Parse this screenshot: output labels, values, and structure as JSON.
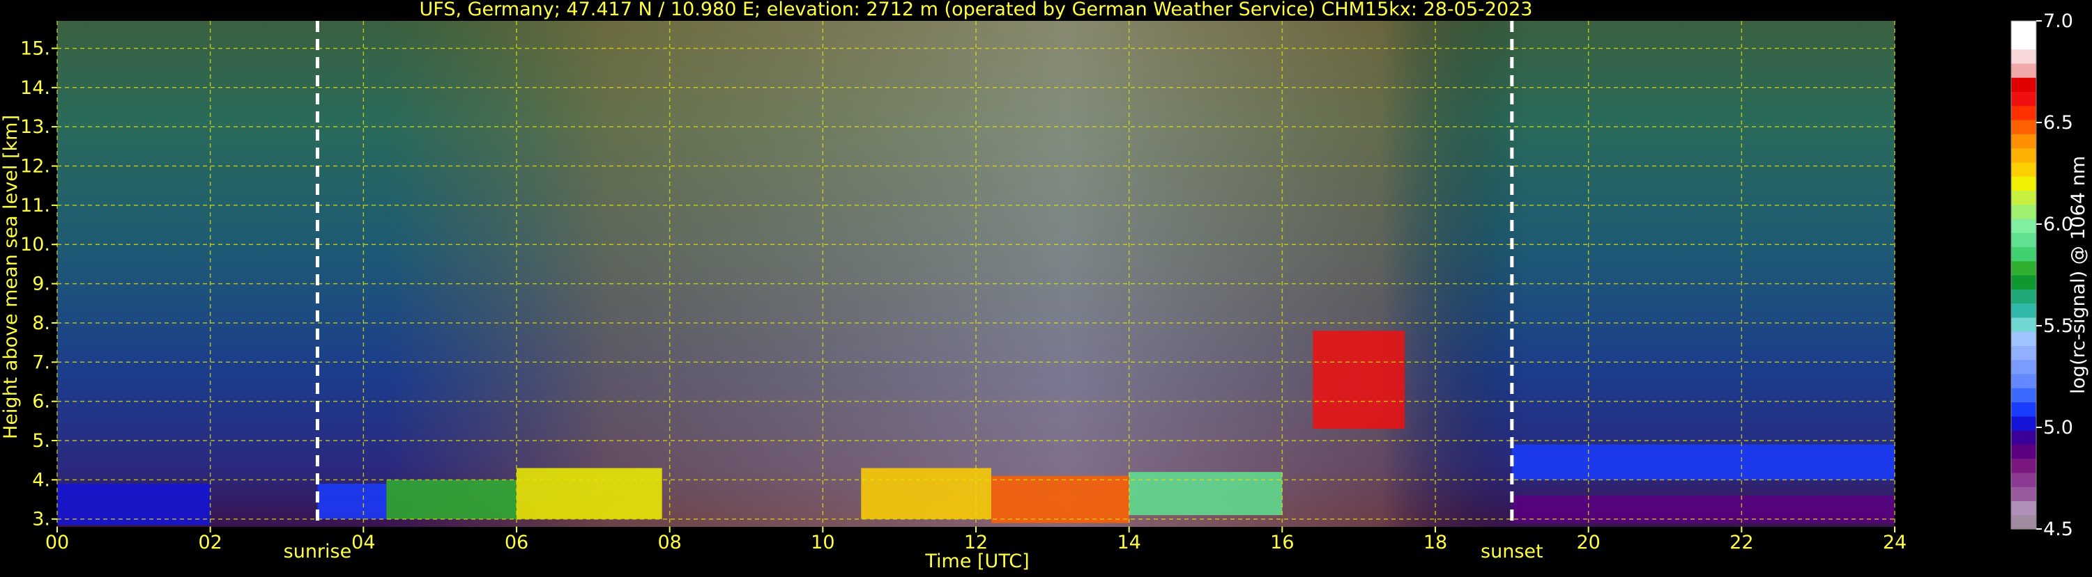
{
  "chart_data": {
    "type": "heatmap",
    "title": "UFS, Germany; 47.417 N / 10.980 E; elevation: 2712 m  (operated by German Weather Service)    CHM15kx: 28-05-2023",
    "xlabel": "Time [UTC]",
    "ylabel": "Height above mean sea level [km]",
    "xlim": [
      0,
      24
    ],
    "ylim": [
      2.8,
      15.7
    ],
    "x_ticks": [
      0,
      2,
      4,
      6,
      8,
      10,
      12,
      14,
      16,
      18,
      20,
      22,
      24
    ],
    "x_tick_labels": [
      "00",
      "02",
      "04",
      "06",
      "08",
      "10",
      "12",
      "14",
      "16",
      "18",
      "20",
      "22",
      "24"
    ],
    "y_ticks": [
      3,
      4,
      5,
      6,
      7,
      8,
      9,
      10,
      11,
      12,
      13,
      14,
      15
    ],
    "y_tick_labels": [
      "3.",
      "4.",
      "5.",
      "6.",
      "7.",
      "8.",
      "9.",
      "10.",
      "11.",
      "12.",
      "13.",
      "14.",
      "15."
    ],
    "grid": true,
    "vertical_markers": [
      {
        "label": "sunrise",
        "x": 3.4
      },
      {
        "label": "sunset",
        "x": 19.0
      }
    ],
    "colorbar": {
      "label": "log(rc-signal) @ 1064 nm",
      "range": [
        4.5,
        7.0
      ],
      "tick_values": [
        4.5,
        5.0,
        5.5,
        6.0,
        6.5,
        7.0
      ],
      "tick_labels": [
        "4.5",
        "5.0",
        "5.5",
        "6.0",
        "6.5",
        "7.0"
      ],
      "colors": [
        "#a08aa0",
        "#b090b8",
        "#9a5aa0",
        "#8a3a90",
        "#7a1880",
        "#5a0080",
        "#3a0098",
        "#1414d8",
        "#1a3cff",
        "#3c6aff",
        "#6488ff",
        "#7a9cff",
        "#90b0ff",
        "#a0c4ff",
        "#70d8d0",
        "#30b8a8",
        "#20a878",
        "#109830",
        "#30b030",
        "#40d070",
        "#60e090",
        "#80f0a0",
        "#a0f070",
        "#c8f040",
        "#f0f000",
        "#ffd000",
        "#ffb000",
        "#ff9000",
        "#ff6000",
        "#ff3000",
        "#f01010",
        "#e00000",
        "#f0a8a8",
        "#f8d8d8",
        "#ffffff",
        "#ffffff"
      ]
    },
    "aerosol_layers": [
      {
        "t0": 0.0,
        "t1": 2.0,
        "h0": 2.85,
        "h1": 3.9,
        "v": 5.0
      },
      {
        "t0": 3.4,
        "t1": 4.3,
        "h0": 3.0,
        "h1": 3.9,
        "v": 5.1
      },
      {
        "t0": 4.3,
        "t1": 6.0,
        "h0": 3.0,
        "h1": 4.0,
        "v": 5.8
      },
      {
        "t0": 6.0,
        "t1": 7.9,
        "h0": 3.0,
        "h1": 4.3,
        "v": 6.2
      },
      {
        "t0": 10.5,
        "t1": 12.2,
        "h0": 3.0,
        "h1": 4.3,
        "v": 6.3
      },
      {
        "t0": 12.2,
        "t1": 14.0,
        "h0": 2.9,
        "h1": 4.1,
        "v": 6.5
      },
      {
        "t0": 14.0,
        "t1": 16.0,
        "h0": 3.1,
        "h1": 4.2,
        "v": 5.9
      },
      {
        "t0": 16.4,
        "t1": 17.6,
        "h0": 5.3,
        "h1": 7.8,
        "v": 6.6
      },
      {
        "t0": 19.0,
        "t1": 24.0,
        "h0": 4.0,
        "h1": 4.9,
        "v": 5.1
      },
      {
        "t0": 19.0,
        "t1": 24.0,
        "h0": 2.9,
        "h1": 3.6,
        "v": 4.9
      }
    ]
  }
}
